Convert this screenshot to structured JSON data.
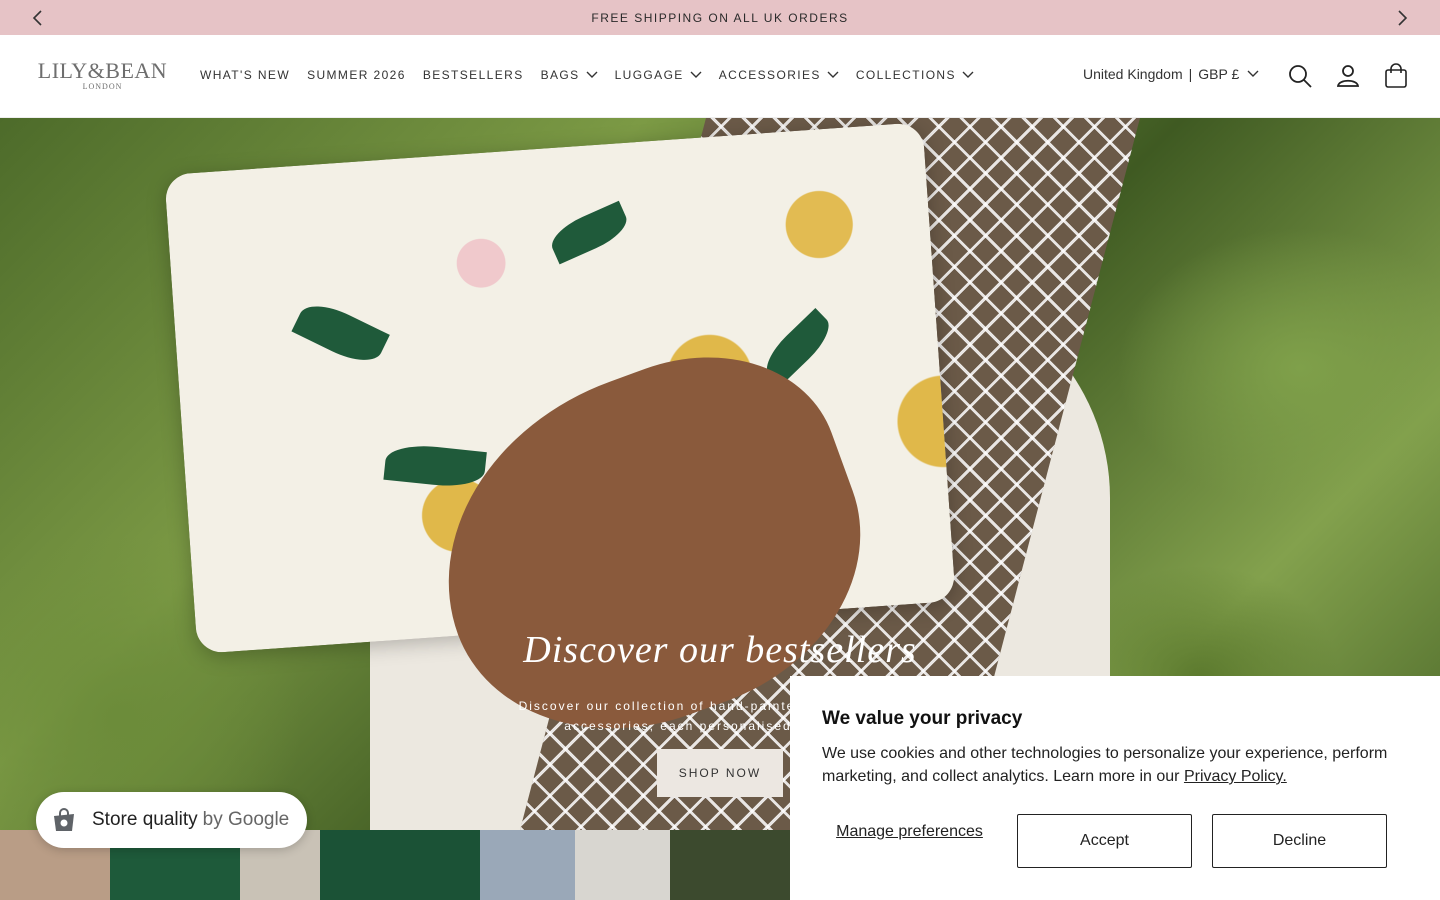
{
  "announcement": {
    "text": "FREE SHIPPING ON ALL UK ORDERS"
  },
  "logo": {
    "main": "LILY&BEAN",
    "sub": "LONDON"
  },
  "nav": [
    {
      "label": "WHAT'S NEW",
      "dropdown": false
    },
    {
      "label": "SUMMER 2026",
      "dropdown": false
    },
    {
      "label": "BESTSELLERS",
      "dropdown": false
    },
    {
      "label": "BAGS",
      "dropdown": true
    },
    {
      "label": "LUGGAGE",
      "dropdown": true
    },
    {
      "label": "ACCESSORIES",
      "dropdown": true
    },
    {
      "label": "COLLECTIONS",
      "dropdown": true
    }
  ],
  "locale": {
    "country": "United Kingdom",
    "separator": "|",
    "currency": "GBP £"
  },
  "header_icons": [
    "search-icon",
    "account-icon",
    "cart-icon"
  ],
  "hero": {
    "title": "Discover our bestsellers",
    "subtitle_line1": "Discover our collection of hand-painted, hand-beaded e",
    "subtitle_line2": "accessories, each personalised to create a",
    "button": "SHOP NOW"
  },
  "google_badge": {
    "label": "Store quality",
    "suffix": "by Google"
  },
  "cookie": {
    "title": "We value your privacy",
    "text": "We use cookies and other technologies to personalize your experience, perform marketing, and collect analytics. Learn more in our ",
    "link": "Privacy Policy.",
    "manage": "Manage preferences",
    "accept": "Accept",
    "decline": "Decline"
  },
  "colors": {
    "announcement_bg": "#e6c3c6",
    "button_bg": "#ece7e1",
    "text": "#222222"
  }
}
